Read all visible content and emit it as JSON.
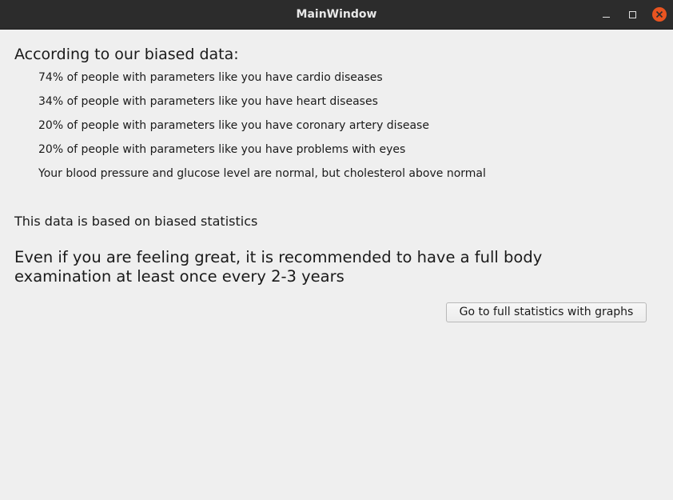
{
  "window": {
    "title": "MainWindow"
  },
  "titlebar_buttons": {
    "minimize_icon": "minimize-icon",
    "maximize_icon": "maximize-icon",
    "close_icon": "close-icon",
    "close_color": "#e95420"
  },
  "content": {
    "heading": "According to our biased data:",
    "stats": [
      "74% of people with parameters like you have cardio diseases",
      "34% of people with parameters like you have heart diseases",
      "20% of people with parameters like you have coronary artery disease",
      "20% of people with parameters like you have problems with eyes",
      "Your blood pressure and glucose level are normal, but cholesterol above normal"
    ],
    "note": "This data is based on biased statistics",
    "recommendation": "Even if you are feeling great, it is recommended to have a full body examination at least once every 2-3 years",
    "button_label": "Go to full statistics with graphs"
  }
}
